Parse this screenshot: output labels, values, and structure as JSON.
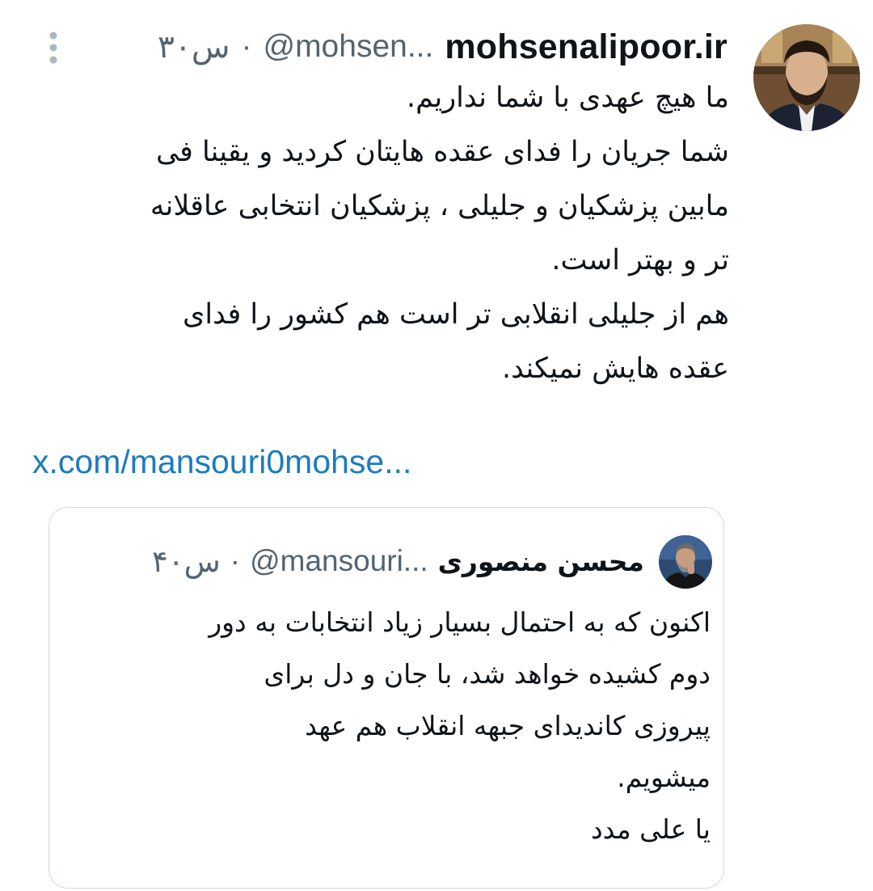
{
  "tweet": {
    "display_name": "mohsenalipoor.ir",
    "handle": "@mohsen...",
    "separator": "·",
    "time": "۳۰س",
    "avatar_icon": "profile-photo",
    "more_icon": "vertical-ellipsis-icon",
    "text_lines": [
      "ما هیچ عهدی با شما نداریم.",
      "شما جریان را فدای عقده هایتان کردید و یقینا فی",
      "مابین پزشکیان و جلیلی ، پزشکیان انتخابی عاقلانه",
      "تر و بهتر است.",
      "هم از جلیلی انقلابی تر است هم کشور را فدای",
      "عقده هایش نمیکند."
    ],
    "link": "x.com/mansouri0mohse..."
  },
  "quoted_tweet": {
    "display_name": "محسن منصوری",
    "handle": "@mansouri...",
    "separator": "·",
    "time": "۴۰س",
    "avatar_icon": "profile-photo",
    "text_lines": [
      "اکنون که به احتمال بسیار زیاد انتخابات به دور",
      "دوم کشیده خواهد شد،  با جان و دل برای",
      "پیروزی کاندیدای جبهه انقلاب هم عهد",
      "میشویم.",
      "یا علی مدد"
    ]
  },
  "colors": {
    "text_primary": "#0f1419",
    "text_secondary": "#536471",
    "link": "#1d7bc0",
    "border": "#cfd9de"
  }
}
